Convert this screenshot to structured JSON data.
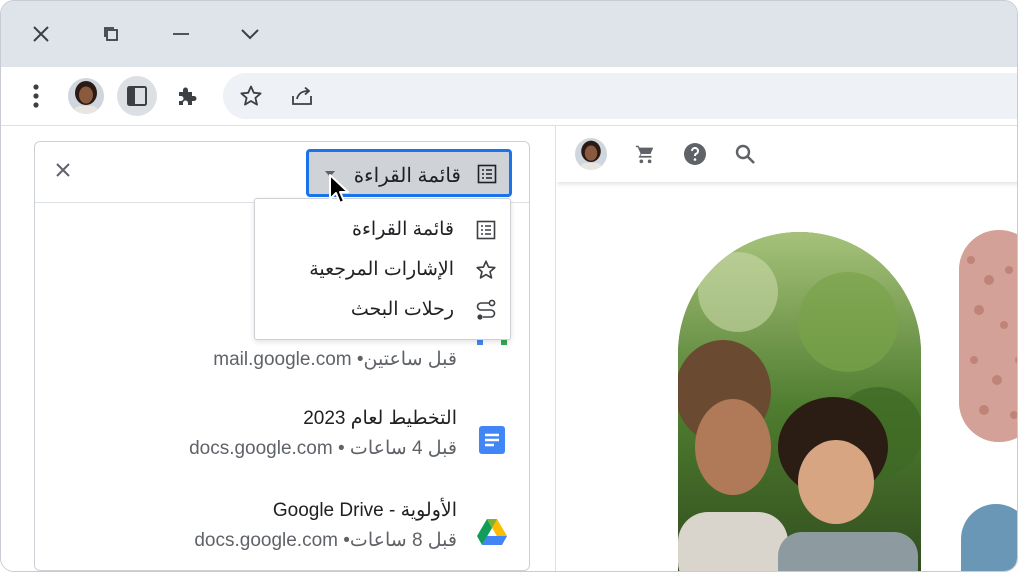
{
  "window_controls": {
    "close": "close-icon",
    "restore": "restore-icon",
    "minimize": "minimize-icon",
    "expand": "chevron-down-icon"
  },
  "toolbar": {
    "items": [
      "more-vertical-icon",
      "profile-avatar",
      "side-panel-icon",
      "extensions-icon",
      "star-icon",
      "share-icon"
    ]
  },
  "side_panel": {
    "selector_label": "قائمة القراءة",
    "items": [
      {
        "title": "",
        "meta": "قبل ساعتين• mail.google.com",
        "icon": "gmail-icon",
        "color": "#ea4335"
      },
      {
        "title": "التخطيط لعام 2023",
        "meta": "قبل 4 ساعات • docs.google.com",
        "icon": "docs-icon",
        "color": "#4285f4"
      },
      {
        "title": "الأولوية - Google Drive",
        "meta": "قبل 8 ساعات• docs.google.com",
        "icon": "drive-icon",
        "color": "#34a853"
      }
    ]
  },
  "dropdown": {
    "items": [
      {
        "label": "قائمة القراءة",
        "icon": "reading-list-icon"
      },
      {
        "label": "الإشارات المرجعية",
        "icon": "star-icon"
      },
      {
        "label": "رحلات البحث",
        "icon": "journeys-icon"
      }
    ]
  },
  "site_header": {
    "icons": [
      "profile-avatar",
      "cart-icon",
      "help-icon",
      "search-icon"
    ]
  },
  "colors": {
    "accent": "#1a73e8",
    "titlebar": "#dfe3ea",
    "selector_bg": "#cfd2d6"
  }
}
